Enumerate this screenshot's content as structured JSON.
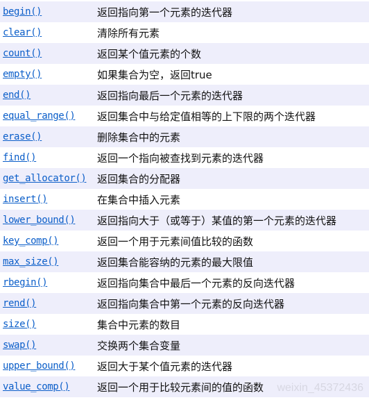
{
  "rows": [
    {
      "fn": "begin()",
      "desc": "返回指向第一个元素的迭代器"
    },
    {
      "fn": "clear()",
      "desc": "清除所有元素"
    },
    {
      "fn": "count()",
      "desc": "返回某个值元素的个数"
    },
    {
      "fn": "empty()",
      "desc": "如果集合为空，返回true"
    },
    {
      "fn": "end()",
      "desc": "返回指向最后一个元素的迭代器"
    },
    {
      "fn": "equal_range()",
      "desc": "返回集合中与给定值相等的上下限的两个迭代器"
    },
    {
      "fn": "erase()",
      "desc": "删除集合中的元素"
    },
    {
      "fn": "find()",
      "desc": "返回一个指向被查找到元素的迭代器"
    },
    {
      "fn": "get_allocator()",
      "desc": "返回集合的分配器"
    },
    {
      "fn": "insert()",
      "desc": "在集合中插入元素"
    },
    {
      "fn": "lower_bound()",
      "desc": "返回指向大于（或等于）某值的第一个元素的迭代器"
    },
    {
      "fn": "key_comp()",
      "desc": "返回一个用于元素间值比较的函数"
    },
    {
      "fn": "max_size()",
      "desc": "返回集合能容纳的元素的最大限值"
    },
    {
      "fn": "rbegin()",
      "desc": "返回指向集合中最后一个元素的反向迭代器"
    },
    {
      "fn": "rend()",
      "desc": "返回指向集合中第一个元素的反向迭代器"
    },
    {
      "fn": "size()",
      "desc": "集合中元素的数目"
    },
    {
      "fn": "swap()",
      "desc": "交换两个集合变量"
    },
    {
      "fn": "upper_bound()",
      "desc": "返回大于某个值元素的迭代器"
    },
    {
      "fn": "value_comp()",
      "desc": "返回一个用于比较元素间的值的函数"
    }
  ],
  "watermark": "weixin_45372436",
  "colors": {
    "link": "#0b5ec9",
    "row_alt": "#eeeefb"
  }
}
